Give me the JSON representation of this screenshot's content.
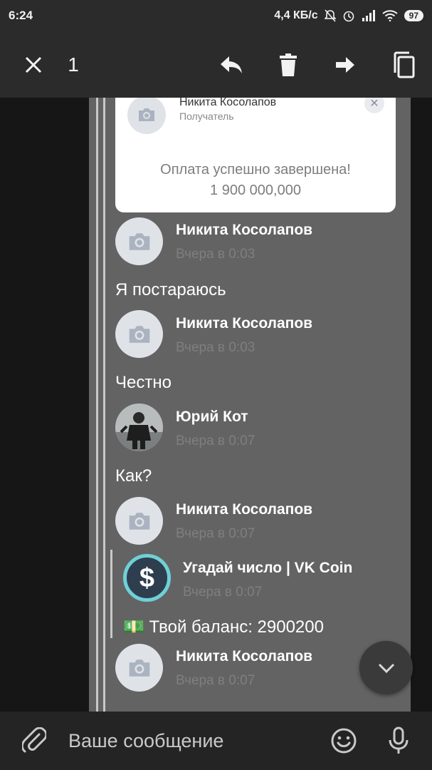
{
  "status_bar": {
    "time": "6:24",
    "network_speed": "4,4 КБ/с",
    "battery": "97"
  },
  "toolbar": {
    "selected_count": "1"
  },
  "payment_card": {
    "recipient_name": "Никита Косолапов",
    "recipient_role": "Получатель",
    "status": "Оплата успешно завершена!",
    "amount": "1 900 000,000"
  },
  "messages": [
    {
      "sender": "Никита Косолапов",
      "time": "Вчера в 0:03",
      "text": "Я постараюсь"
    },
    {
      "sender": "Никита Косолапов",
      "time": "Вчера в 0:03",
      "text": "Честно"
    },
    {
      "sender": "Юрий Кот",
      "time": "Вчера в 0:07",
      "text": "Как?"
    },
    {
      "sender": "Никита Косолапов",
      "time": "Вчера в 0:07"
    },
    {
      "sender": "Никита Косолапов",
      "time": "Вчера в 0:07"
    }
  ],
  "forwarded": {
    "sender": "Угадай число | VK Coin",
    "time": "Вчера в 0:07",
    "text": "💵 Твой баланс: 2900200"
  },
  "input": {
    "placeholder": "Ваше сообщение"
  },
  "colors": {
    "toolbar": "#2b2b2b",
    "content_bg": "#636363",
    "coin_ring": "#6fd0d7"
  },
  "icons": {
    "close": "close-icon",
    "reply": "reply-icon",
    "delete": "trash-icon",
    "forward": "forward-icon",
    "copy": "copy-icon",
    "attach": "paperclip-icon",
    "emoji": "smile-icon",
    "mic": "microphone-icon",
    "scroll_down": "chevron-down-icon"
  }
}
